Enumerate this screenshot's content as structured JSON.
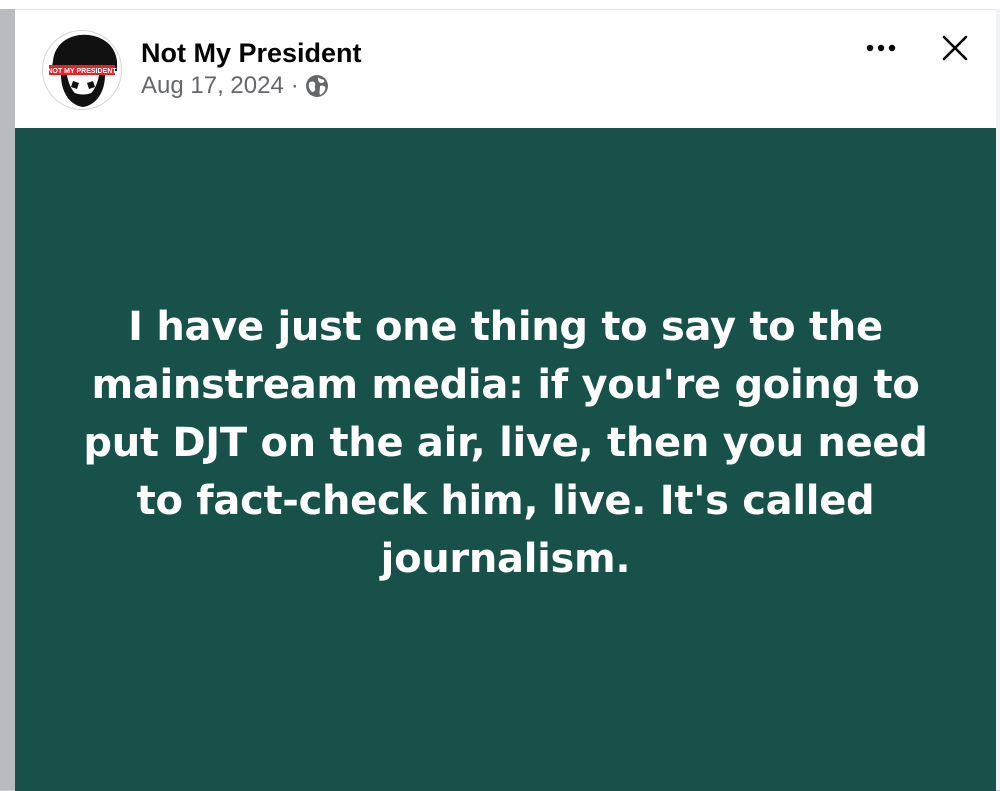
{
  "post": {
    "author": "Not My President",
    "date": "Aug 17, 2024",
    "separator": "·",
    "privacy_icon": "globe-icon",
    "avatar": {
      "icon": "face-silhouette-icon",
      "banner_text": "NOT MY PRESIDENT",
      "banner_color": "#e0262c"
    },
    "more_icon": "more-horizontal-icon",
    "close_icon": "close-icon",
    "card": {
      "background": "#17514a",
      "text_color": "#ffffff",
      "text": "I have just one thing to say to the mainstream media: if you're going to put DJT on the air, live, then you need to fact-check him, live. It's called journalism."
    }
  }
}
